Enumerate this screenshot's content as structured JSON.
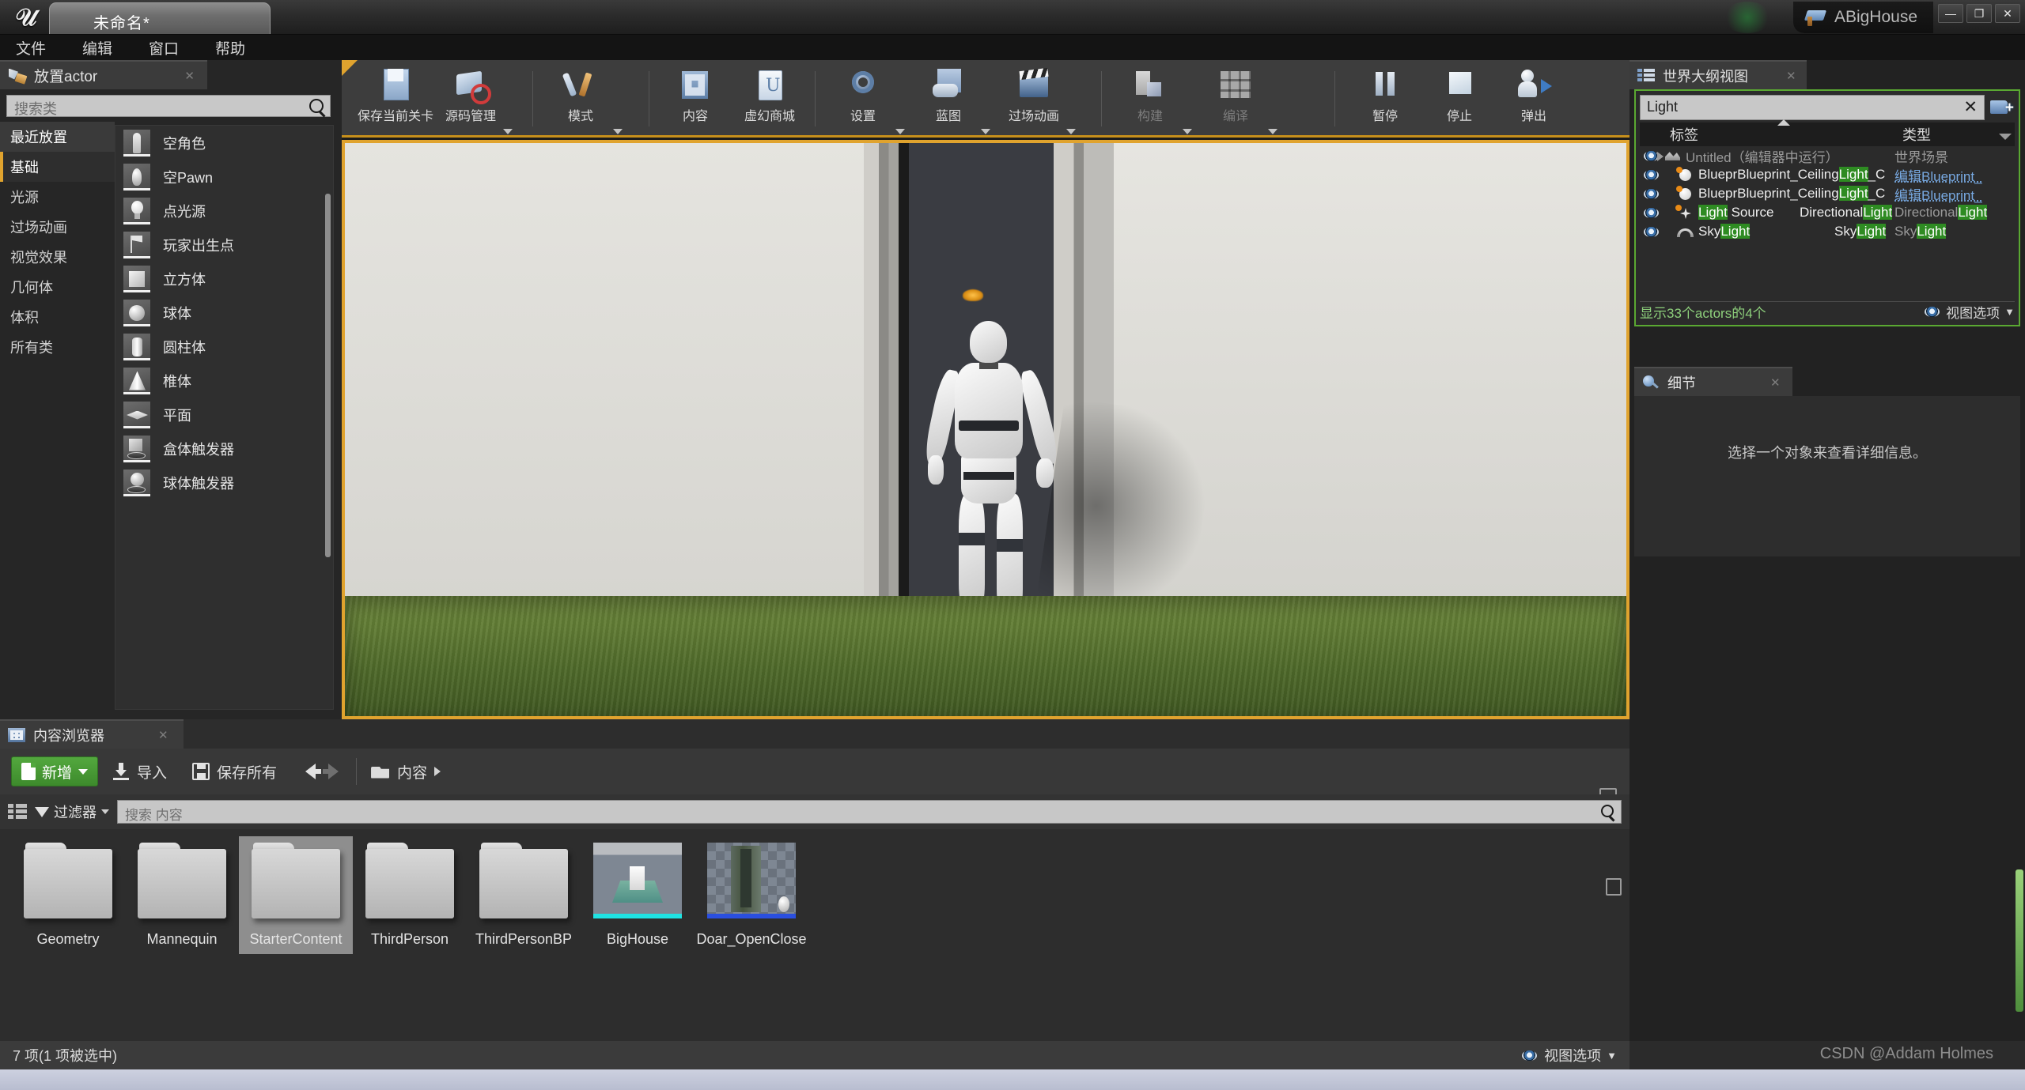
{
  "titlebar": {
    "document_tab": "未命名*",
    "app_name": "ABigHouse",
    "minimize": "—",
    "maximize": "❐",
    "close": "✕"
  },
  "menubar": {
    "items": [
      "文件",
      "编辑",
      "窗口",
      "帮助"
    ]
  },
  "place_actors": {
    "tab_title": "放置actor",
    "close": "✕",
    "search_placeholder": "搜索类",
    "categories": [
      {
        "label": "最近放置",
        "selected": false
      },
      {
        "label": "基础",
        "selected": true
      },
      {
        "label": "光源",
        "selected": false
      },
      {
        "label": "过场动画",
        "selected": false
      },
      {
        "label": "视觉效果",
        "selected": false
      },
      {
        "label": "几何体",
        "selected": false
      },
      {
        "label": "体积",
        "selected": false
      },
      {
        "label": "所有类",
        "selected": false
      }
    ],
    "items": [
      {
        "label": "空角色",
        "icon": "empty-actor-icon"
      },
      {
        "label": "空Pawn",
        "icon": "empty-pawn-icon"
      },
      {
        "label": "点光源",
        "icon": "point-light-icon"
      },
      {
        "label": "玩家出生点",
        "icon": "player-start-icon"
      },
      {
        "label": "立方体",
        "icon": "cube-icon"
      },
      {
        "label": "球体",
        "icon": "sphere-icon"
      },
      {
        "label": "圆柱体",
        "icon": "cylinder-icon"
      },
      {
        "label": "椎体",
        "icon": "cone-icon"
      },
      {
        "label": "平面",
        "icon": "plane-icon"
      },
      {
        "label": "盒体触发器",
        "icon": "box-trigger-icon"
      },
      {
        "label": "球体触发器",
        "icon": "sphere-trigger-icon"
      }
    ]
  },
  "toolbar": {
    "buttons": [
      {
        "label": "保存当前关卡",
        "icon": "save-icon",
        "dropdown": false,
        "disabled": false
      },
      {
        "label": "源码管理",
        "icon": "source-control-icon",
        "dropdown": true,
        "disabled": false
      },
      {
        "label": "模式",
        "icon": "modes-icon",
        "dropdown": true,
        "disabled": false
      },
      {
        "label": "内容",
        "icon": "content-icon",
        "dropdown": false,
        "disabled": false
      },
      {
        "label": "虚幻商城",
        "icon": "marketplace-icon",
        "dropdown": false,
        "disabled": false
      },
      {
        "label": "设置",
        "icon": "settings-icon",
        "dropdown": true,
        "disabled": false
      },
      {
        "label": "蓝图",
        "icon": "blueprint-icon",
        "dropdown": true,
        "disabled": false
      },
      {
        "label": "过场动画",
        "icon": "cinematics-icon",
        "dropdown": true,
        "disabled": false
      },
      {
        "label": "构建",
        "icon": "build-icon",
        "dropdown": true,
        "disabled": true
      },
      {
        "label": "编译",
        "icon": "compile-icon",
        "dropdown": true,
        "disabled": true
      },
      {
        "label": "暂停",
        "icon": "pause-icon",
        "dropdown": false,
        "disabled": false
      },
      {
        "label": "停止",
        "icon": "stop-icon",
        "dropdown": false,
        "disabled": false
      },
      {
        "label": "弹出",
        "icon": "eject-icon",
        "dropdown": false,
        "disabled": false
      }
    ]
  },
  "outliner": {
    "tab_title": "世界大纲视图",
    "close": "✕",
    "search_value": "Light",
    "clear_label": "✕",
    "add_button": "create-folder-icon",
    "columns": {
      "label": "标签",
      "type": "类型"
    },
    "rows": [
      {
        "icon": "world-icon",
        "name": "Untitled（编辑器中运行）",
        "mid": "",
        "type": "世界场景",
        "indent": 0,
        "style": "dim"
      },
      {
        "icon": "point-light-icon",
        "name_pre": "Bluepr",
        "name_a": "Blueprint_Ceiling",
        "name_hl": "Light",
        "name_b": "_C",
        "mid": "",
        "type_pre": "编辑Blueprint_",
        "indent": 1,
        "style": "link"
      },
      {
        "icon": "point-light-icon",
        "name_pre": "Bluepr",
        "name_a": "Blueprint_Ceiling",
        "name_hl": "Light",
        "name_b": "_C",
        "mid": "",
        "type_pre": "编辑Blueprint_",
        "indent": 1,
        "style": "link"
      },
      {
        "icon": "directional-light-icon",
        "name_hl": "Light",
        "name_b": " Source",
        "mid_a": "Directional",
        "mid_hl": "Light",
        "type_a": "Directional",
        "type_hl": "Light",
        "indent": 1,
        "style": "white"
      },
      {
        "icon": "sky-light-icon",
        "name_b": "Sky",
        "name_hl": "Light",
        "mid_a": "Sky",
        "mid_hl": "Light",
        "type_a": "Sky",
        "type_hl": "Light",
        "indent": 1,
        "style": "white"
      }
    ],
    "footer_count": "显示33个actors的4个",
    "footer_view_options": "视图选项"
  },
  "details": {
    "tab_title": "细节",
    "close": "✕",
    "empty_message": "选择一个对象来查看详细信息。"
  },
  "content_browser": {
    "tab_title": "内容浏览器",
    "close": "✕",
    "new_button": "新增",
    "import_button": "导入",
    "save_all_button": "保存所有",
    "breadcrumb_root": "内容",
    "filter_button": "过滤器",
    "search_placeholder": "搜索 内容",
    "assets": [
      {
        "name": "Geometry",
        "kind": "folder",
        "selected": false
      },
      {
        "name": "Mannequin",
        "kind": "folder",
        "selected": false
      },
      {
        "name": "StarterContent",
        "kind": "folder",
        "selected": true
      },
      {
        "name": "ThirdPerson",
        "kind": "folder",
        "selected": false
      },
      {
        "name": "ThirdPersonBP",
        "kind": "folder",
        "selected": false
      },
      {
        "name": "BigHouse",
        "kind": "level",
        "selected": false,
        "bar_color": "#1fe3e3"
      },
      {
        "name": "Doar_OpenClose",
        "kind": "blueprint",
        "selected": false,
        "bar_color": "#2a4fe0"
      }
    ],
    "status_left": "7 项(1 项被选中)",
    "status_right": "视图选项"
  },
  "watermark": "CSDN @Addam Holmes",
  "colors": {
    "accent_orange": "#e0a32e",
    "outliner_green": "#5aa832",
    "highlight_green": "#2e8b22",
    "new_button_green": "#53a83e",
    "link_blue": "#77a8e0"
  }
}
